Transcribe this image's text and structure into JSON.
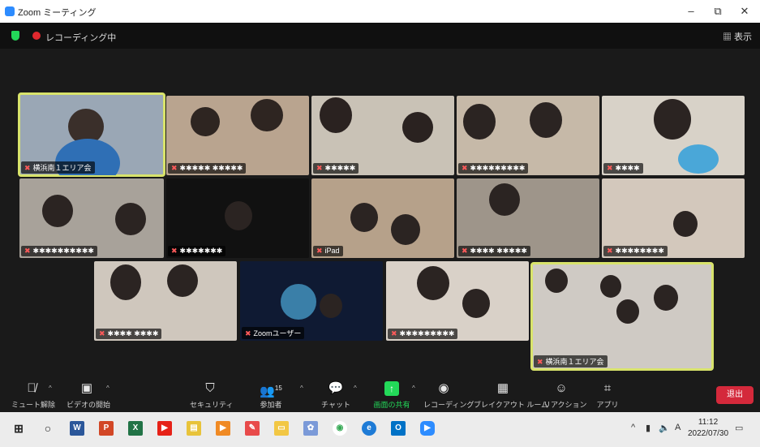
{
  "window": {
    "title": "Zoom ミーティング",
    "min": "–",
    "max": "⧉",
    "close": "✕"
  },
  "topbar": {
    "recording_label": "レコーディング中",
    "view_label": "▦ 表示"
  },
  "participants": [
    {
      "name": "横浜南１エリア会",
      "bg": "#9aa7b5"
    },
    {
      "name": "✱✱✱✱✱ ✱✱✱✱✱",
      "bg": "#b9a48f"
    },
    {
      "name": "✱✱✱✱✱",
      "bg": "#c9c2b6"
    },
    {
      "name": "✱✱✱✱✱✱✱✱✱",
      "bg": "#c6b9a8"
    },
    {
      "name": "✱✱✱✱",
      "bg": "#d8d2c8"
    },
    {
      "name": "✱✱✱✱✱✱✱✱✱✱",
      "bg": "#a8a29a"
    },
    {
      "name": "✱✱✱✱✱✱✱",
      "bg": "#8f7f6e"
    },
    {
      "name": "iPad",
      "bg": "#b6a18a"
    },
    {
      "name": "✱✱✱✱ ✱✱✱✱✱",
      "bg": "#9e958a"
    },
    {
      "name": "✱✱✱✱✱✱✱✱",
      "bg": "#d3c8bc"
    },
    {
      "name": "✱✱✱✱ ✱✱✱✱",
      "bg": "#cfc7bd"
    },
    {
      "name": "Zoomユーザー",
      "bg": "#2c3e6a"
    },
    {
      "name": "✱✱✱✱✱✱✱✱✱",
      "bg": "#d9d1c8"
    },
    {
      "name": "横浜南１エリア会",
      "bg": "#cfcac4"
    }
  ],
  "toolbar": {
    "mute": "ミュート解除",
    "video": "ビデオの開始",
    "security": "セキュリティ",
    "participants": "参加者",
    "participants_count": "15",
    "chat": "チャット",
    "share": "画面の共有",
    "record": "レコーディング",
    "breakout": "ブレイクアウト ルーム",
    "reactions": "リアクション",
    "apps": "アプリ",
    "leave": "退出"
  },
  "taskbar": {
    "time": "11:12",
    "date": "2022/07/30",
    "ime": "A"
  },
  "colors": {
    "share_green": "#23d959",
    "leave_red": "#d4293b",
    "active_border": "#d8e36b"
  }
}
